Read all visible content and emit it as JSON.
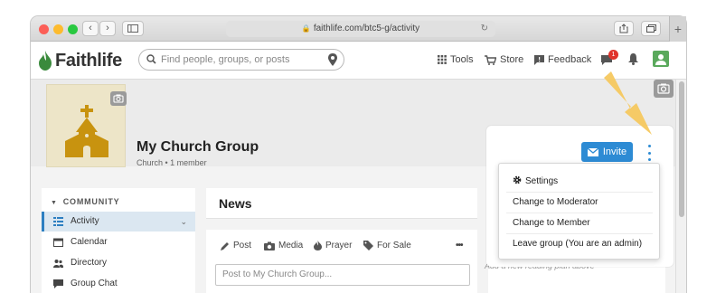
{
  "browser": {
    "url": "faithlife.com/btc5-g/activity",
    "colors": {
      "close": "#fc5f57",
      "minimize": "#fdbb2e",
      "maximize": "#29c840"
    }
  },
  "header": {
    "logo_text": "Faithlife",
    "logo_color": "#3a8a3c",
    "search_placeholder": "Find people, groups, or posts",
    "nav": {
      "tools": "Tools",
      "store": "Store",
      "feedback": "Feedback"
    },
    "notification_count": "1"
  },
  "group": {
    "name": "My Church Group",
    "subtitle": "Church • 1 member"
  },
  "sidebar": {
    "heading": "COMMUNITY",
    "items": [
      {
        "label": "Activity",
        "icon": "activity-icon"
      },
      {
        "label": "Calendar",
        "icon": "calendar-icon"
      },
      {
        "label": "Directory",
        "icon": "directory-icon"
      },
      {
        "label": "Group Chat",
        "icon": "chat-icon"
      }
    ]
  },
  "main": {
    "news_title": "News",
    "actions": [
      {
        "label": "Post",
        "icon": "pencil-icon"
      },
      {
        "label": "Media",
        "icon": "camera-icon"
      },
      {
        "label": "Prayer",
        "icon": "flame-icon"
      },
      {
        "label": "For Sale",
        "icon": "tag-icon"
      }
    ],
    "more": "•••",
    "post_placeholder": "Post to My Church Group..."
  },
  "rightcol": {
    "plan_note": "Add a new reading plan above"
  },
  "popup": {
    "invite_label": "Invite",
    "menu": [
      "Settings",
      "Change to Moderator",
      "Change to Member",
      "Leave group (You are an admin)"
    ],
    "accent": "#2d8bd4",
    "arrow_color": "#f6c85f"
  }
}
